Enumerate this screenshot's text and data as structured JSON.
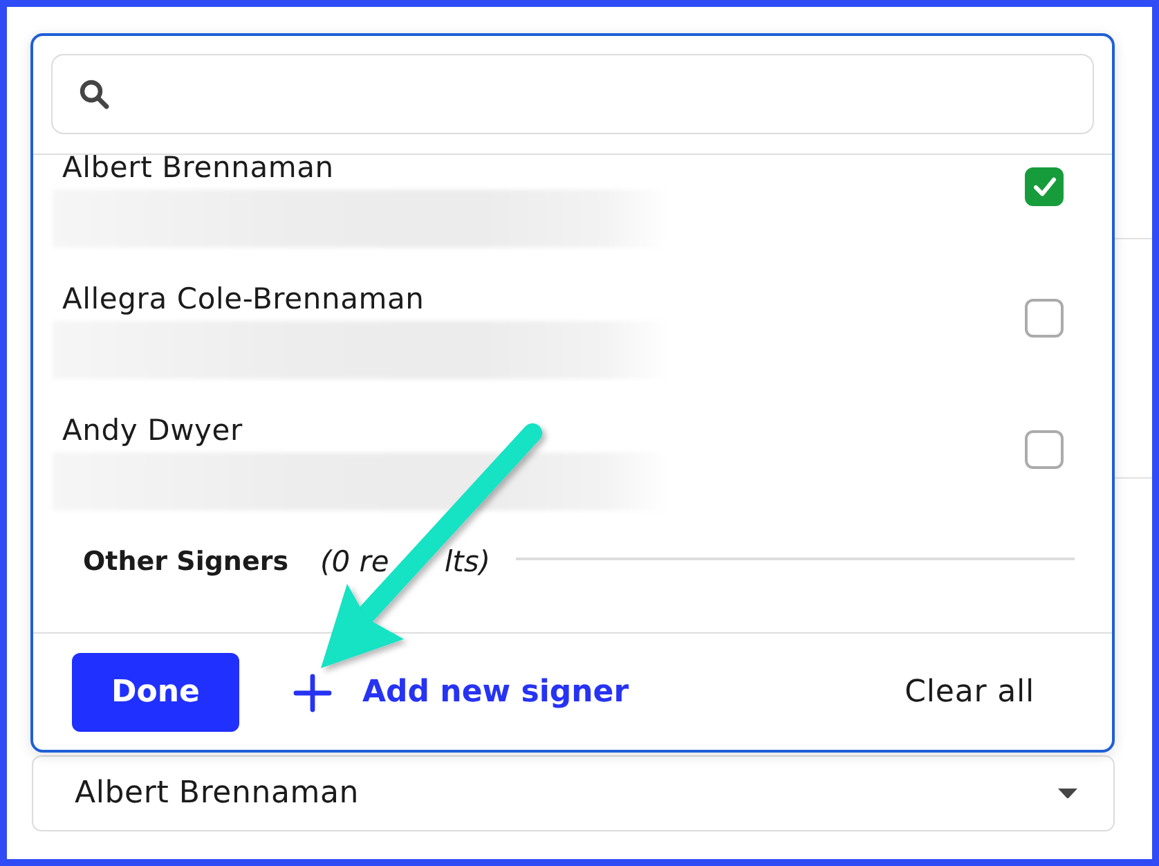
{
  "signers": [
    {
      "name": "Albert Brennaman",
      "checked": true
    },
    {
      "name": "Allegra Cole-Brennaman",
      "checked": false
    },
    {
      "name": "Andy Dwyer",
      "checked": false
    }
  ],
  "other_signers": {
    "title": "Other Signers",
    "count_visible_parts": [
      "(0 re",
      "lts)"
    ]
  },
  "footer": {
    "done_button": "Done",
    "add_signer_button": "Add new signer",
    "clear_button": "Clear all"
  },
  "signer_select": {
    "value": "Albert Brennaman"
  }
}
